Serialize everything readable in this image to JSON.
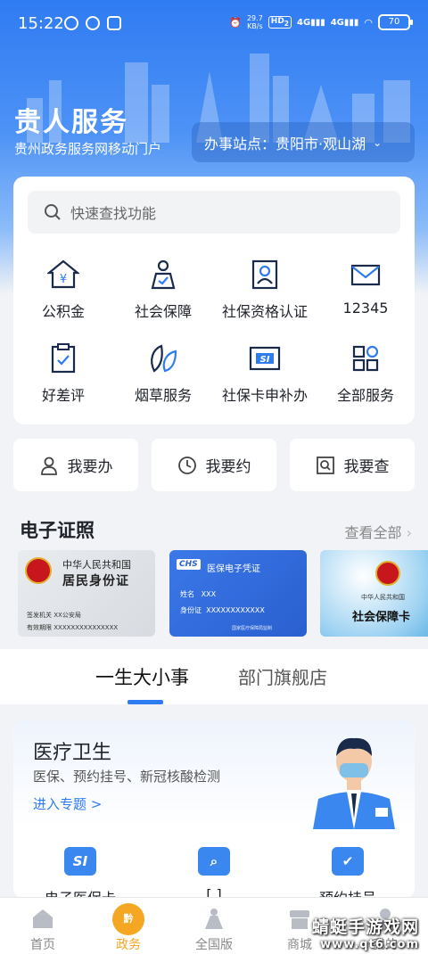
{
  "status_bar": {
    "time": "15:22",
    "net_speed_value": "29.7",
    "net_speed_unit": "KB/s",
    "hd_badge": "HD",
    "hd_index": "2",
    "signal1": "4G",
    "signal2": "4G",
    "battery": "70"
  },
  "brand": {
    "title": "贵人服务",
    "subtitle": "贵州政务服务网移动门户"
  },
  "station": {
    "label": "办事站点：贵阳市·观山湖"
  },
  "search": {
    "placeholder": "快速查找功能"
  },
  "services": [
    {
      "label": "公积金",
      "icon": "housing-fund-icon"
    },
    {
      "label": "社会保障",
      "icon": "social-security-icon"
    },
    {
      "label": "社保资格认证",
      "icon": "qualification-icon"
    },
    {
      "label": "12345",
      "icon": "mail-icon"
    },
    {
      "label": "好差评",
      "icon": "evaluation-icon"
    },
    {
      "label": "烟草服务",
      "icon": "leaf-icon"
    },
    {
      "label": "社保卡申补办",
      "icon": "si-card-icon"
    },
    {
      "label": "全部服务",
      "icon": "grid-icon"
    }
  ],
  "quick_actions": [
    {
      "label": "我要办",
      "icon": "person-icon"
    },
    {
      "label": "我要约",
      "icon": "clock-icon"
    },
    {
      "label": "我要查",
      "icon": "search-doc-icon"
    }
  ],
  "certificates": {
    "title": "电子证照",
    "more": "查看全部",
    "cards": [
      {
        "header": "中华人民共和国",
        "name": "居民身份证",
        "issuer_label": "签发机关",
        "issuer_value": "XX公安局",
        "validity_label": "有效期限",
        "validity_value": "XXXXXXXXXXXXXXX"
      },
      {
        "logo": "CHS",
        "title": "医保电子凭证",
        "name_label": "姓名",
        "name_value": "XXX",
        "id_label": "身份证",
        "id_value": "XXXXXXXXXXXX",
        "footer": "国家医疗保障局监制"
      },
      {
        "header": "中华人民共和国",
        "name": "社会保障卡"
      }
    ]
  },
  "tabs": [
    {
      "label": "一生大小事",
      "active": true
    },
    {
      "label": "部门旗舰店",
      "active": false
    }
  ],
  "theme": {
    "title": "医疗卫生",
    "desc": "医保、预约挂号、新冠核酸检测",
    "enter": "进入专题 >",
    "services": [
      {
        "label": "电子医保卡",
        "icon": "si-card-icon",
        "mark": "SI"
      },
      {
        "label": "[        ]",
        "icon": "search-bag-icon",
        "mark": ""
      },
      {
        "label": "预约挂号",
        "icon": "calendar-check-icon",
        "mark": ""
      }
    ]
  },
  "bottom_nav": [
    {
      "label": "首页",
      "icon": "home-icon",
      "active": false
    },
    {
      "label": "政务",
      "icon": "gov-icon",
      "active": true,
      "badge": "黔"
    },
    {
      "label": "全国版",
      "icon": "national-icon",
      "active": false
    },
    {
      "label": "商城",
      "icon": "shop-icon",
      "active": false
    },
    {
      "label": "我的",
      "icon": "user-icon",
      "active": false
    }
  ],
  "watermark": {
    "line1": "蜻蜓手游戏网",
    "line2": "www.qt6.com"
  },
  "colors": {
    "primary": "#2f7bf2",
    "accent": "#f5a623",
    "background": "#f1f3f6"
  }
}
